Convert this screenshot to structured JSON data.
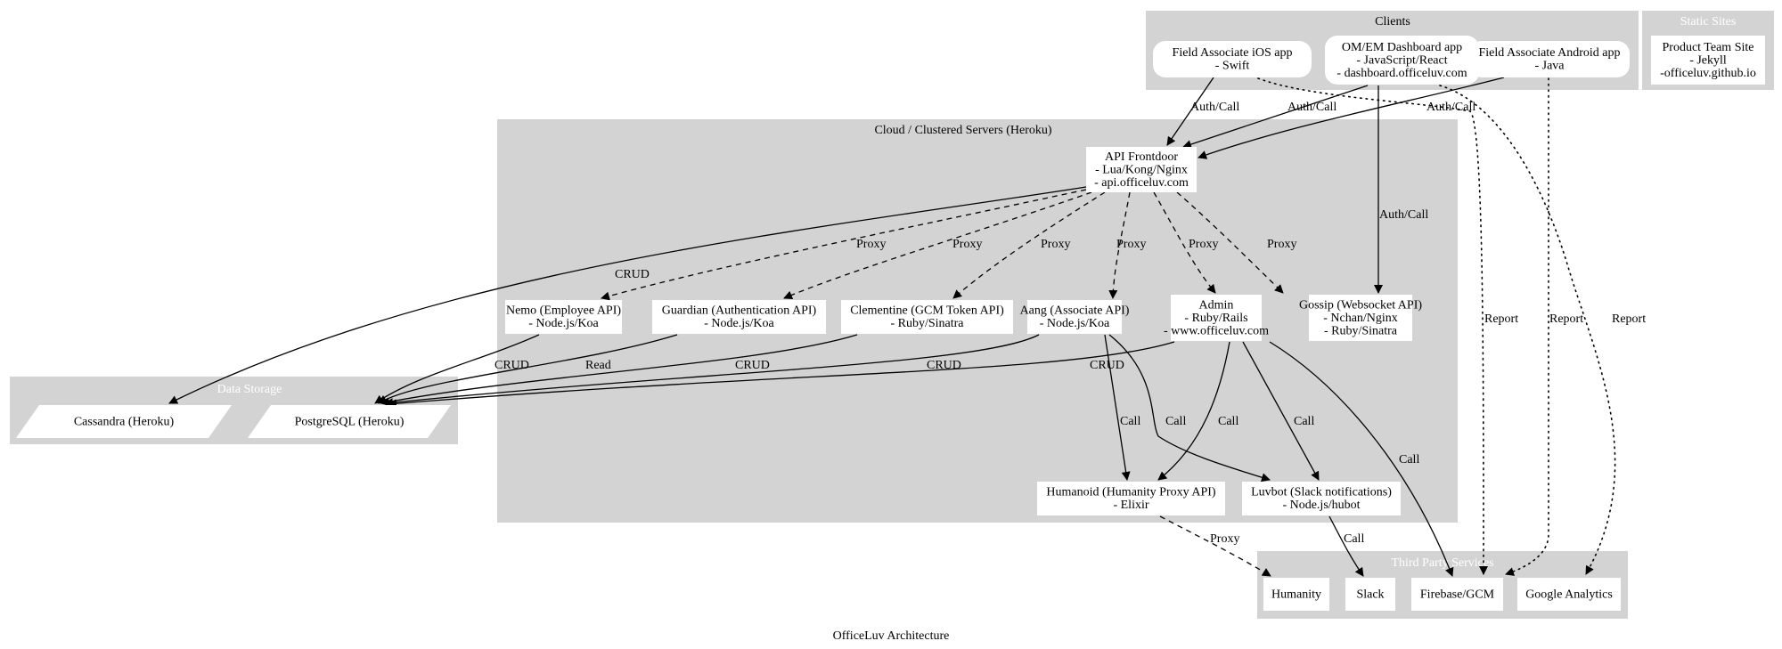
{
  "caption": "OfficeLuv Architecture",
  "colors": {
    "cluster_fill": "#d3d3d3",
    "node_fill": "#ffffff",
    "edge": "#000000",
    "light_label": "#ffffff"
  },
  "clusters": {
    "clients": {
      "label": "Clients",
      "label_color": "dark"
    },
    "static_sites": {
      "label": "Static Sites",
      "label_color": "light"
    },
    "cloud": {
      "label": "Cloud / Clustered Servers (Heroku)",
      "label_color": "dark"
    },
    "data_storage": {
      "label": "Data Storage",
      "label_color": "light"
    },
    "third_party": {
      "label": "Third Party Services",
      "label_color": "light"
    }
  },
  "nodes": {
    "ios": {
      "lines": [
        "Field Associate iOS app",
        "- Swift"
      ],
      "shape": "rounded"
    },
    "dashboard": {
      "lines": [
        "OM/EM Dashboard app",
        "- JavaScript/React",
        "- dashboard.officeluv.com"
      ],
      "shape": "rounded"
    },
    "android": {
      "lines": [
        "Field Associate Android app",
        "- Java"
      ],
      "shape": "rounded"
    },
    "product_site": {
      "lines": [
        "Product Team Site",
        "- Jekyll",
        "-officeluv.github.io"
      ],
      "shape": "box"
    },
    "frontdoor": {
      "lines": [
        "API Frontdoor",
        "- Lua/Kong/Nginx",
        "- api.officeluv.com"
      ],
      "shape": "box"
    },
    "nemo": {
      "lines": [
        "Nemo (Employee API)",
        "- Node.js/Koa"
      ],
      "shape": "box"
    },
    "guardian": {
      "lines": [
        "Guardian (Authentication API)",
        "- Node.js/Koa"
      ],
      "shape": "box"
    },
    "clementine": {
      "lines": [
        "Clementine (GCM Token API)",
        "- Ruby/Sinatra"
      ],
      "shape": "box"
    },
    "aang": {
      "lines": [
        "Aang (Associate API)",
        "- Node.js/Koa"
      ],
      "shape": "box"
    },
    "admin": {
      "lines": [
        "Admin",
        "- Ruby/Rails",
        "- www.officeluv.com"
      ],
      "shape": "box"
    },
    "gossip": {
      "lines": [
        "Gossip (Websocket API)",
        "- Nchan/Nginx",
        "- Ruby/Sinatra"
      ],
      "shape": "box"
    },
    "humanoid": {
      "lines": [
        "Humanoid (Humanity Proxy API)",
        "- Elixir"
      ],
      "shape": "box"
    },
    "luvbot": {
      "lines": [
        "Luvbot (Slack notifications)",
        "- Node.js/hubot"
      ],
      "shape": "box"
    },
    "cassandra": {
      "lines": [
        "Cassandra (Heroku)"
      ],
      "shape": "parallelogram"
    },
    "postgres": {
      "lines": [
        "PostgreSQL (Heroku)"
      ],
      "shape": "parallelogram"
    },
    "humanity": {
      "lines": [
        "Humanity"
      ],
      "shape": "box"
    },
    "slack": {
      "lines": [
        "Slack"
      ],
      "shape": "box"
    },
    "firebase": {
      "lines": [
        "Firebase/GCM"
      ],
      "shape": "box"
    },
    "google_analytics": {
      "lines": [
        "Google Analytics"
      ],
      "shape": "box"
    }
  },
  "edges": [
    {
      "id": "ios-frontdoor",
      "from": "ios",
      "to": "frontdoor",
      "label": "Auth/Call",
      "style": "solid"
    },
    {
      "id": "dashboard-frontdoor",
      "from": "dashboard",
      "to": "frontdoor",
      "label": "Auth/Call",
      "style": "solid"
    },
    {
      "id": "android-frontdoor",
      "from": "android",
      "to": "frontdoor",
      "label": "Auth/Call",
      "style": "solid"
    },
    {
      "id": "dashboard-gossip",
      "from": "dashboard",
      "to": "gossip",
      "label": "Auth/Call",
      "style": "solid"
    },
    {
      "id": "ios-firebase",
      "from": "ios",
      "to": "firebase",
      "label": "Report",
      "style": "dotted"
    },
    {
      "id": "android-firebase",
      "from": "android",
      "to": "firebase",
      "label": "Report",
      "style": "dotted"
    },
    {
      "id": "dashboard-ga",
      "from": "dashboard",
      "to": "google_analytics",
      "label": "Report",
      "style": "dotted"
    },
    {
      "id": "frontdoor-cassandra",
      "from": "frontdoor",
      "to": "cassandra",
      "label": "CRUD",
      "style": "solid"
    },
    {
      "id": "frontdoor-nemo",
      "from": "frontdoor",
      "to": "nemo",
      "label": "Proxy",
      "style": "dashed"
    },
    {
      "id": "frontdoor-guardian",
      "from": "frontdoor",
      "to": "guardian",
      "label": "Proxy",
      "style": "dashed"
    },
    {
      "id": "frontdoor-clementine",
      "from": "frontdoor",
      "to": "clementine",
      "label": "Proxy",
      "style": "dashed"
    },
    {
      "id": "frontdoor-aang",
      "from": "frontdoor",
      "to": "aang",
      "label": "Proxy",
      "style": "dashed"
    },
    {
      "id": "frontdoor-admin",
      "from": "frontdoor",
      "to": "admin",
      "label": "Proxy",
      "style": "dashed"
    },
    {
      "id": "frontdoor-gossip",
      "from": "frontdoor",
      "to": "gossip",
      "label": "Proxy",
      "style": "dashed"
    },
    {
      "id": "nemo-postgres",
      "from": "nemo",
      "to": "postgres",
      "label": "CRUD",
      "style": "solid"
    },
    {
      "id": "guardian-postgres",
      "from": "guardian",
      "to": "postgres",
      "label": "Read",
      "style": "solid"
    },
    {
      "id": "clementine-postgres",
      "from": "clementine",
      "to": "postgres",
      "label": "CRUD",
      "style": "solid"
    },
    {
      "id": "aang-postgres",
      "from": "aang",
      "to": "postgres",
      "label": "CRUD",
      "style": "solid"
    },
    {
      "id": "admin-postgres",
      "from": "admin",
      "to": "postgres",
      "label": "CRUD",
      "style": "solid"
    },
    {
      "id": "aang-humanoid",
      "from": "aang",
      "to": "humanoid",
      "label": "Call",
      "style": "solid"
    },
    {
      "id": "aang-luvbot",
      "from": "aang",
      "to": "luvbot",
      "label": "Call",
      "style": "solid"
    },
    {
      "id": "admin-humanoid",
      "from": "admin",
      "to": "humanoid",
      "label": "Call",
      "style": "solid"
    },
    {
      "id": "admin-luvbot",
      "from": "admin",
      "to": "luvbot",
      "label": "Call",
      "style": "solid"
    },
    {
      "id": "admin-firebase",
      "from": "admin",
      "to": "firebase",
      "label": "Call",
      "style": "solid"
    },
    {
      "id": "humanoid-humanity",
      "from": "humanoid",
      "to": "humanity",
      "label": "Proxy",
      "style": "dashed"
    },
    {
      "id": "luvbot-slack",
      "from": "luvbot",
      "to": "slack",
      "label": "Call",
      "style": "solid"
    }
  ]
}
